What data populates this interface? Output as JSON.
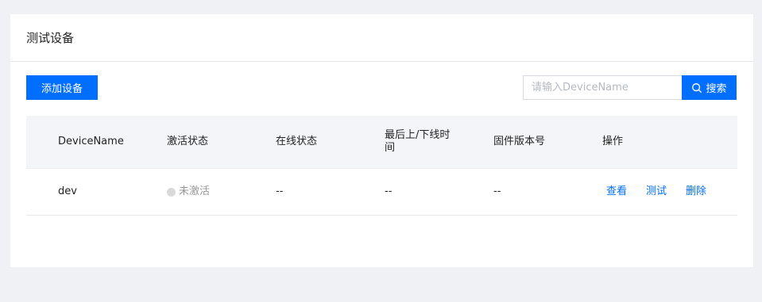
{
  "card": {
    "title": "测试设备"
  },
  "toolbar": {
    "add_label": "添加设备",
    "search_placeholder": "请输入DeviceName",
    "search_label": "搜索"
  },
  "table": {
    "headers": [
      "DeviceName",
      "激活状态",
      "在线状态",
      "最后上/下线时间",
      "固件版本号",
      "操作"
    ],
    "rows": [
      {
        "device_name": "dev",
        "activation": "未激活",
        "online": "--",
        "last_time": "--",
        "firmware": "--",
        "actions": [
          "查看",
          "测试",
          "删除"
        ]
      }
    ]
  },
  "colors": {
    "primary": "#006eff",
    "inactive_dot": "#d9d9d9",
    "background": "#f0f1f4"
  }
}
